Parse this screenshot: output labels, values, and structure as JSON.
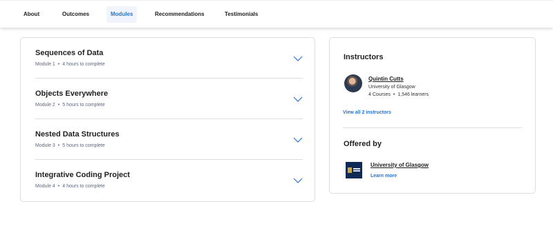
{
  "tabs": [
    {
      "label": "About",
      "active": false
    },
    {
      "label": "Outcomes",
      "active": false
    },
    {
      "label": "Modules",
      "active": true
    },
    {
      "label": "Recommendations",
      "active": false
    },
    {
      "label": "Testimonials",
      "active": false
    }
  ],
  "modules": [
    {
      "title": "Sequences of Data",
      "number": "Module 1",
      "duration": "4 hours to complete"
    },
    {
      "title": "Objects Everywhere",
      "number": "Module 2",
      "duration": "5 hours to complete"
    },
    {
      "title": "Nested Data Structures",
      "number": "Module 3",
      "duration": "5 hours to complete"
    },
    {
      "title": "Integrative Coding Project",
      "number": "Module 4",
      "duration": "4 hours to complete"
    }
  ],
  "meta_separator": "•",
  "instructors": {
    "heading": "Instructors",
    "name": "Quintin Cutts",
    "organization": "University of Glasgow",
    "courses": "4 Courses",
    "learners": "1,546 learners",
    "view_all": "View all 2 instructors"
  },
  "offered_by": {
    "heading": "Offered by",
    "name": "University of Glasgow",
    "learn_more": "Learn more"
  },
  "colors": {
    "accent": "#2a73cc",
    "border": "#dadde2",
    "text": "#1f1f1f",
    "muted": "#5b6780"
  },
  "icons": {
    "expand": "chevron-down-icon",
    "avatar": "instructor-avatar",
    "logo": "university-logo"
  }
}
